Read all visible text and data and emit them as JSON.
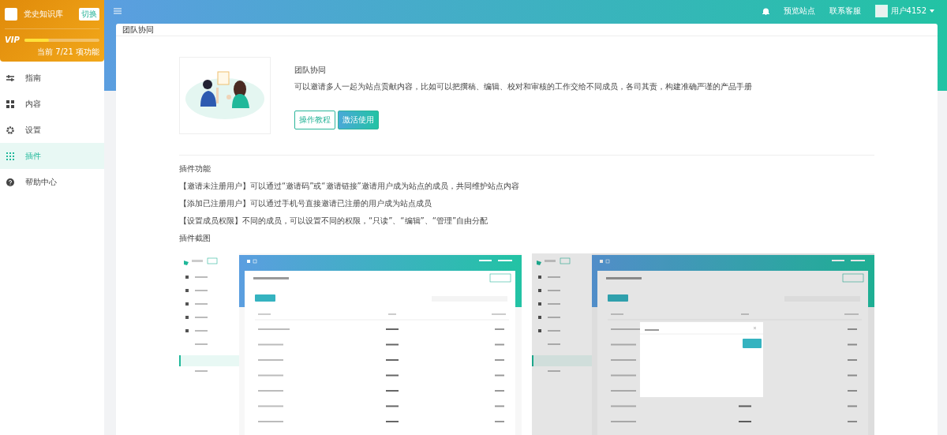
{
  "sidebar": {
    "brand": {
      "name": "党史知识库",
      "switch_label": "切换"
    },
    "vip": {
      "label": "VIP",
      "level": 0.33,
      "progress_text": "当前 7/21 项功能"
    },
    "items": [
      {
        "label": "指南",
        "selected": false
      },
      {
        "label": "内容",
        "selected": false
      },
      {
        "label": "设置",
        "selected": false
      },
      {
        "label": "插件",
        "selected": true
      },
      {
        "label": "帮助中心",
        "selected": false
      }
    ]
  },
  "topbar": {
    "links": [
      "预览站点",
      "联系客服"
    ],
    "user": "用户4152"
  },
  "page": {
    "title": "团队协同",
    "plugin": {
      "title": "团队协同",
      "description": "可以邀请多人一起为站点贡献内容，比如可以把撰稿、编辑、校对和审核的工作交给不同成员，各司其责，构建准确严谨的产品手册",
      "buttons": [
        {
          "label": "操作教程",
          "kind": "outline"
        },
        {
          "label": "激活使用",
          "kind": "primary"
        }
      ]
    },
    "features": {
      "heading": "插件功能",
      "items": [
        "【邀请未注册用户】可以通过“邀请码”或“邀请链接”邀请用户成为站点的成员，共同维护站点内容",
        "【添加已注册用户】可以通过手机号直接邀请已注册的用户成为站点成员",
        "【设置成员权限】不同的成员，可以设置不同的权限，“只读”、“编辑”、“管理”自由分配"
      ]
    },
    "screenshots": {
      "heading": "插件截图",
      "items": [
        {
          "dialog_open": false
        },
        {
          "dialog_open": true
        }
      ]
    }
  }
}
